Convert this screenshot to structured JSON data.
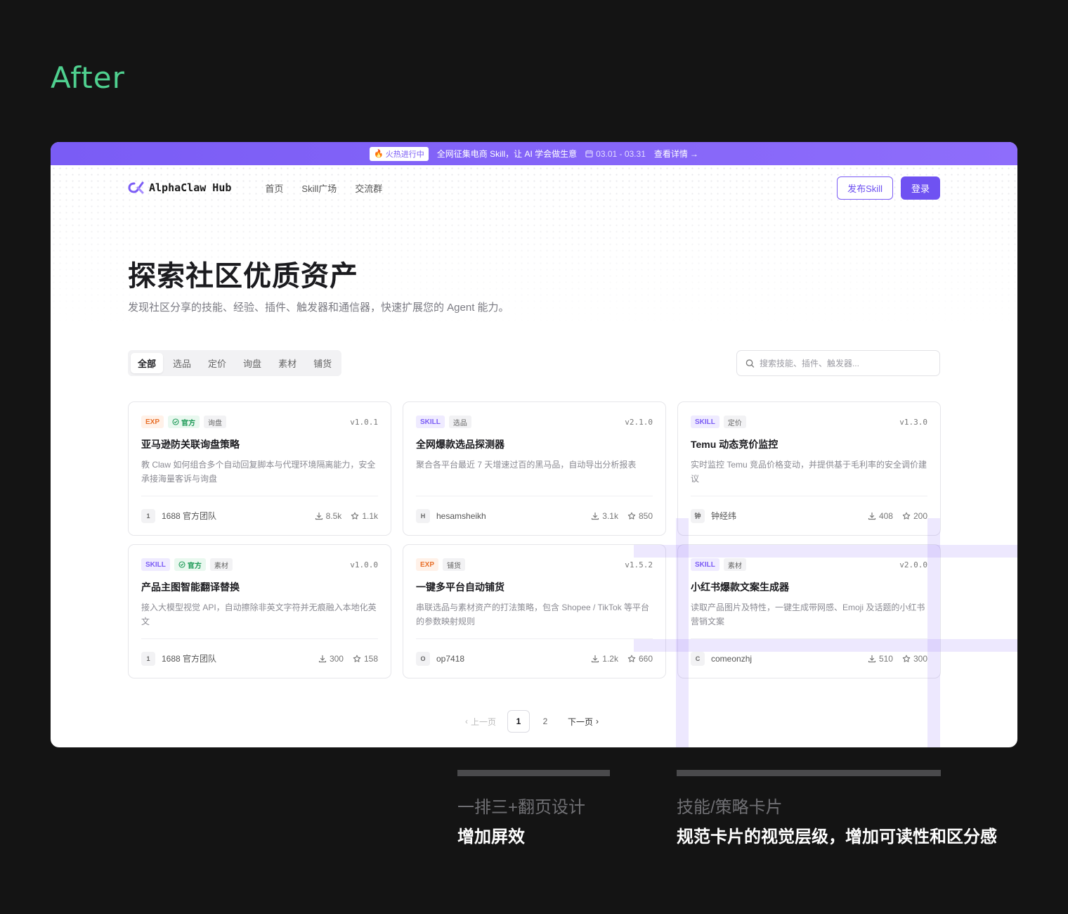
{
  "heading": "After",
  "banner": {
    "tag": "火热进行中",
    "text": "全网征集电商 Skill，让 AI 学会做生意",
    "date": "03.01 - 03.31",
    "link": "查看详情"
  },
  "nav": {
    "logo": "AlphaClaw Hub",
    "links": [
      "首页",
      "Skill广场",
      "交流群"
    ],
    "publish": "发布Skill",
    "login": "登录"
  },
  "hero": {
    "title": "探索社区优质资产",
    "subtitle": "发现社区分享的技能、经验、插件、触发器和通信器，快速扩展您的 Agent 能力。"
  },
  "filters": [
    "全部",
    "选品",
    "定价",
    "询盘",
    "素材",
    "铺货"
  ],
  "search": {
    "placeholder": "搜索技能、插件、触发器..."
  },
  "cards": [
    {
      "type": "EXP",
      "official": "官方",
      "category": "询盘",
      "version": "v1.0.1",
      "title": "亚马逊防关联询盘策略",
      "desc": "教 Claw 如何组合多个自动回复脚本与代理环境隔离能力，安全承接海量客诉与询盘",
      "avatar": "1",
      "author": "1688 官方团队",
      "downloads": "8.5k",
      "stars": "1.1k"
    },
    {
      "type": "SKILL",
      "official": "",
      "category": "选品",
      "version": "v2.1.0",
      "title": "全网爆款选品探测器",
      "desc": "聚合各平台最近 7 天增速过百的黑马品，自动导出分析报表",
      "avatar": "H",
      "author": "hesamsheikh",
      "downloads": "3.1k",
      "stars": "850"
    },
    {
      "type": "SKILL",
      "official": "",
      "category": "定价",
      "version": "v1.3.0",
      "title": "Temu 动态竞价监控",
      "desc": "实时监控 Temu 竞品价格变动，并提供基于毛利率的安全调价建议",
      "avatar": "钟",
      "author": "钟经纬",
      "downloads": "408",
      "stars": "200"
    },
    {
      "type": "SKILL",
      "official": "官方",
      "category": "素材",
      "version": "v1.0.0",
      "title": "产品主图智能翻译替换",
      "desc": "接入大模型视觉 API，自动擦除非英文字符并无痕融入本地化英文",
      "avatar": "1",
      "author": "1688 官方团队",
      "downloads": "300",
      "stars": "158"
    },
    {
      "type": "EXP",
      "official": "",
      "category": "铺货",
      "version": "v1.5.2",
      "title": "一键多平台自动铺货",
      "desc": "串联选品与素材资产的打法策略，包含 Shopee / TikTok 等平台的参数映射规则",
      "avatar": "O",
      "author": "op7418",
      "downloads": "1.2k",
      "stars": "660"
    },
    {
      "type": "SKILL",
      "official": "",
      "category": "素材",
      "version": "v2.0.0",
      "title": "小红书爆款文案生成器",
      "desc": "读取产品图片及特性，一键生成带网感、Emoji 及话题的小红书营销文案",
      "avatar": "C",
      "author": "comeonzhj",
      "downloads": "510",
      "stars": "300"
    }
  ],
  "pager": {
    "prev": "上一页",
    "pages": [
      "1",
      "2"
    ],
    "next": "下一页"
  },
  "notes": [
    {
      "line1": "一排三+翻页设计",
      "line2": "增加屏效"
    },
    {
      "line1": "技能/策略卡片",
      "line2": "规范卡片的视觉层级，增加可读性和区分感"
    }
  ],
  "colors": {
    "accent": "#6f52f2",
    "heading": "#4fd08f",
    "background": "#141414"
  }
}
